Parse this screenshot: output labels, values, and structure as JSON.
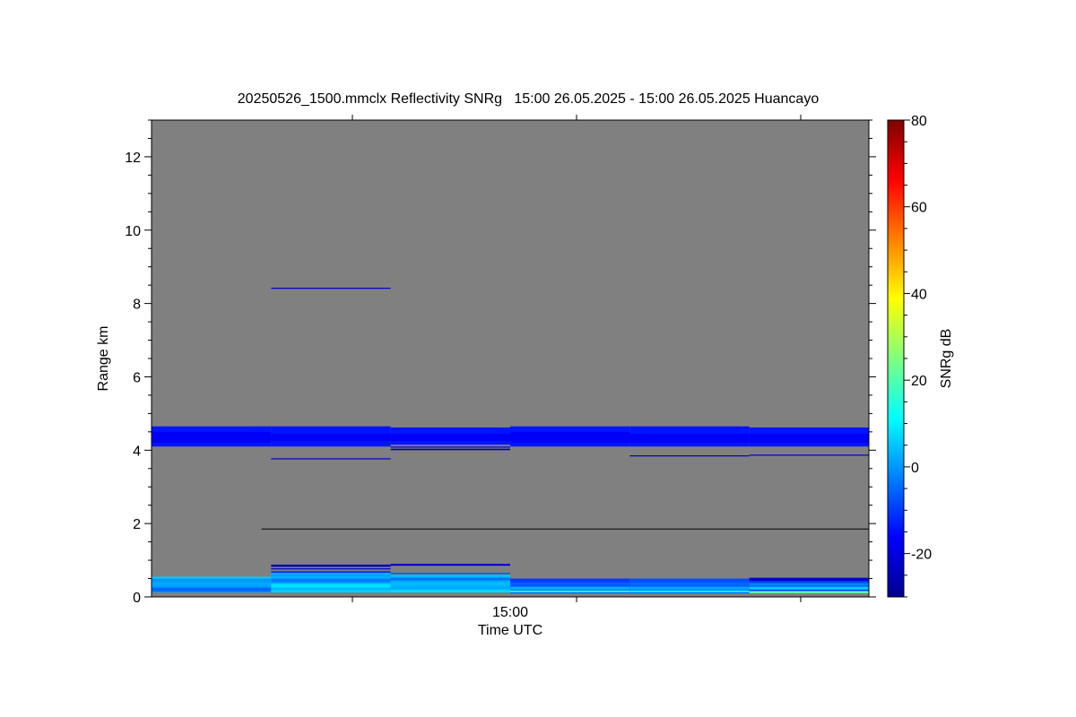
{
  "chart_data": {
    "type": "heatmap",
    "title": "20250526_1500.mmclx Reflectivity SNRg   15:00 26.05.2025 - 15:00 26.05.2025 Huancayo",
    "xlabel": "Time UTC",
    "ylabel": "Range km",
    "x_tick_labels": [
      "15:00"
    ],
    "ylim": [
      0,
      13
    ],
    "y_ticks": [
      0,
      2,
      4,
      6,
      8,
      10,
      12
    ],
    "y_tick_labels": [
      "0",
      "2",
      "4",
      "6",
      "8",
      "10",
      "12"
    ],
    "time_columns": 6,
    "background_color": "#808080",
    "colorbar": {
      "label": "SNRg dB",
      "range": [
        -30,
        80
      ],
      "ticks": [
        -20,
        0,
        20,
        40,
        60,
        80
      ],
      "tick_labels": [
        "-20",
        "0",
        "20",
        "40",
        "60",
        "80"
      ],
      "colormap": "jet"
    },
    "cells": [
      {
        "c0": 0,
        "c1": 1,
        "y0": 4.1,
        "y1": 4.65,
        "v": -14
      },
      {
        "c0": 0,
        "c1": 1,
        "y0": 4.2,
        "y1": 4.5,
        "v": -17
      },
      {
        "c0": 1,
        "c1": 2,
        "y0": 4.1,
        "y1": 4.65,
        "v": -14
      },
      {
        "c0": 1,
        "c1": 2,
        "y0": 4.25,
        "y1": 4.45,
        "v": -17
      },
      {
        "c0": 2,
        "c1": 3,
        "y0": 4.15,
        "y1": 4.62,
        "v": -14
      },
      {
        "c0": 2,
        "c1": 3,
        "y0": 4.25,
        "y1": 4.45,
        "v": -17
      },
      {
        "c0": 3,
        "c1": 4,
        "y0": 4.1,
        "y1": 4.65,
        "v": -14
      },
      {
        "c0": 3,
        "c1": 4,
        "y0": 4.2,
        "y1": 4.5,
        "v": -17
      },
      {
        "c0": 4,
        "c1": 5,
        "y0": 4.1,
        "y1": 4.65,
        "v": -14
      },
      {
        "c0": 4,
        "c1": 5,
        "y0": 4.2,
        "y1": 4.45,
        "v": -17
      },
      {
        "c0": 5,
        "c1": 6,
        "y0": 4.1,
        "y1": 4.62,
        "v": -14
      },
      {
        "c0": 5,
        "c1": 6,
        "y0": 4.2,
        "y1": 4.45,
        "v": -17
      },
      {
        "c0": 1,
        "c1": 2,
        "y0": 8.4,
        "y1": 8.43,
        "v": -22
      },
      {
        "c0": 1,
        "c1": 2,
        "y0": 3.75,
        "y1": 3.78,
        "v": -22
      },
      {
        "c0": 2,
        "c1": 3,
        "y0": 4.0,
        "y1": 4.04,
        "v": -25
      },
      {
        "c0": 2,
        "c1": 3,
        "y0": 4.07,
        "y1": 4.1,
        "v": -22
      },
      {
        "c0": 4,
        "c1": 5,
        "y0": 3.83,
        "y1": 3.86,
        "v": -22
      },
      {
        "c0": 5,
        "c1": 6,
        "y0": 3.85,
        "y1": 3.88,
        "v": -22
      },
      {
        "c0": 0,
        "c1": 1,
        "y0": 0.12,
        "y1": 0.55,
        "v": 0
      },
      {
        "c0": 0,
        "c1": 1,
        "y0": 0.15,
        "y1": 0.25,
        "v": -5
      },
      {
        "c0": 0,
        "c1": 1,
        "y0": 0.3,
        "y1": 0.4,
        "v": 2
      },
      {
        "c0": 0,
        "c1": 1,
        "y0": 0.5,
        "y1": 0.55,
        "v": 6
      },
      {
        "c0": 1,
        "c1": 2,
        "y0": 0.12,
        "y1": 0.65,
        "v": 3
      },
      {
        "c0": 1,
        "c1": 2,
        "y0": 0.12,
        "y1": 0.2,
        "v": 6
      },
      {
        "c0": 1,
        "c1": 2,
        "y0": 0.25,
        "y1": 0.35,
        "v": 8
      },
      {
        "c0": 1,
        "c1": 2,
        "y0": 0.4,
        "y1": 0.5,
        "v": -3
      },
      {
        "c0": 1,
        "c1": 2,
        "y0": 0.55,
        "y1": 0.62,
        "v": 1
      },
      {
        "c0": 1,
        "c1": 2,
        "y0": 0.66,
        "y1": 0.7,
        "v": -12
      },
      {
        "c0": 1,
        "c1": 2,
        "y0": 0.75,
        "y1": 0.78,
        "v": -20
      },
      {
        "c0": 1,
        "c1": 2,
        "y0": 0.82,
        "y1": 0.88,
        "v": -24
      },
      {
        "c0": 2,
        "c1": 3,
        "y0": 0.12,
        "y1": 0.6,
        "v": 2
      },
      {
        "c0": 2,
        "c1": 3,
        "y0": 0.12,
        "y1": 0.2,
        "v": 7
      },
      {
        "c0": 2,
        "c1": 3,
        "y0": 0.3,
        "y1": 0.4,
        "v": 4
      },
      {
        "c0": 2,
        "c1": 3,
        "y0": 0.45,
        "y1": 0.52,
        "v": -4
      },
      {
        "c0": 2,
        "c1": 3,
        "y0": 0.55,
        "y1": 0.6,
        "v": 5
      },
      {
        "c0": 2,
        "c1": 3,
        "y0": 0.62,
        "y1": 0.66,
        "v": -6
      },
      {
        "c0": 2,
        "c1": 3,
        "y0": 0.85,
        "y1": 0.9,
        "v": -22
      },
      {
        "c0": 3,
        "c1": 4,
        "y0": 0.1,
        "y1": 0.5,
        "v": -10
      },
      {
        "c0": 3,
        "c1": 4,
        "y0": 0.12,
        "y1": 0.18,
        "v": 15
      },
      {
        "c0": 3,
        "c1": 4,
        "y0": 0.2,
        "y1": 0.28,
        "v": 3
      },
      {
        "c0": 3,
        "c1": 4,
        "y0": 0.3,
        "y1": 0.4,
        "v": -6
      },
      {
        "c0": 4,
        "c1": 5,
        "y0": 0.1,
        "y1": 0.5,
        "v": -8
      },
      {
        "c0": 4,
        "c1": 5,
        "y0": 0.12,
        "y1": 0.18,
        "v": 10
      },
      {
        "c0": 4,
        "c1": 5,
        "y0": 0.2,
        "y1": 0.28,
        "v": 2
      },
      {
        "c0": 4,
        "c1": 5,
        "y0": 0.3,
        "y1": 0.4,
        "v": -5
      },
      {
        "c0": 5,
        "c1": 6,
        "y0": 0.1,
        "y1": 0.52,
        "v": -10
      },
      {
        "c0": 5,
        "c1": 6,
        "y0": 0.1,
        "y1": 0.16,
        "v": 22
      },
      {
        "c0": 5,
        "c1": 6,
        "y0": 0.2,
        "y1": 0.28,
        "v": 6
      },
      {
        "c0": 5,
        "c1": 6,
        "y0": 0.3,
        "y1": 0.38,
        "v": -2
      },
      {
        "c0": 5,
        "c1": 6,
        "y0": 0.44,
        "y1": 0.52,
        "v": -22
      }
    ],
    "lines": [
      {
        "c0": 0.92,
        "c1": 6,
        "y": 1.85,
        "color": "#000000"
      }
    ]
  }
}
